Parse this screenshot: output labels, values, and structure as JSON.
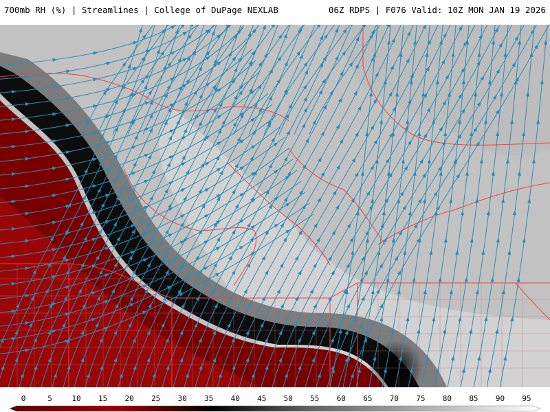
{
  "header": {
    "left_title": "700mb RH (%) | Streamlines | College of DuPage NEXLAB",
    "right_title": "06Z RDPS | F076 Valid: 10Z MON JAN 19 2026"
  },
  "colorbar": {
    "ticks": [
      "0",
      "5",
      "10",
      "15",
      "20",
      "25",
      "30",
      "35",
      "40",
      "45",
      "50",
      "55",
      "60",
      "65",
      "70",
      "75",
      "80",
      "85",
      "90",
      "95"
    ],
    "colors": {
      "dry_dark": "#5a0000",
      "dry_mid": "#a00000",
      "transition": "#000000",
      "moist_low": "#5a5a5a",
      "moist_high": "#d8d8d8",
      "max": "#ffffff"
    }
  },
  "map": {
    "streamline_color": "#2b8cb8",
    "border_color": "#ff3b3b",
    "county_color": "#c87070"
  }
}
